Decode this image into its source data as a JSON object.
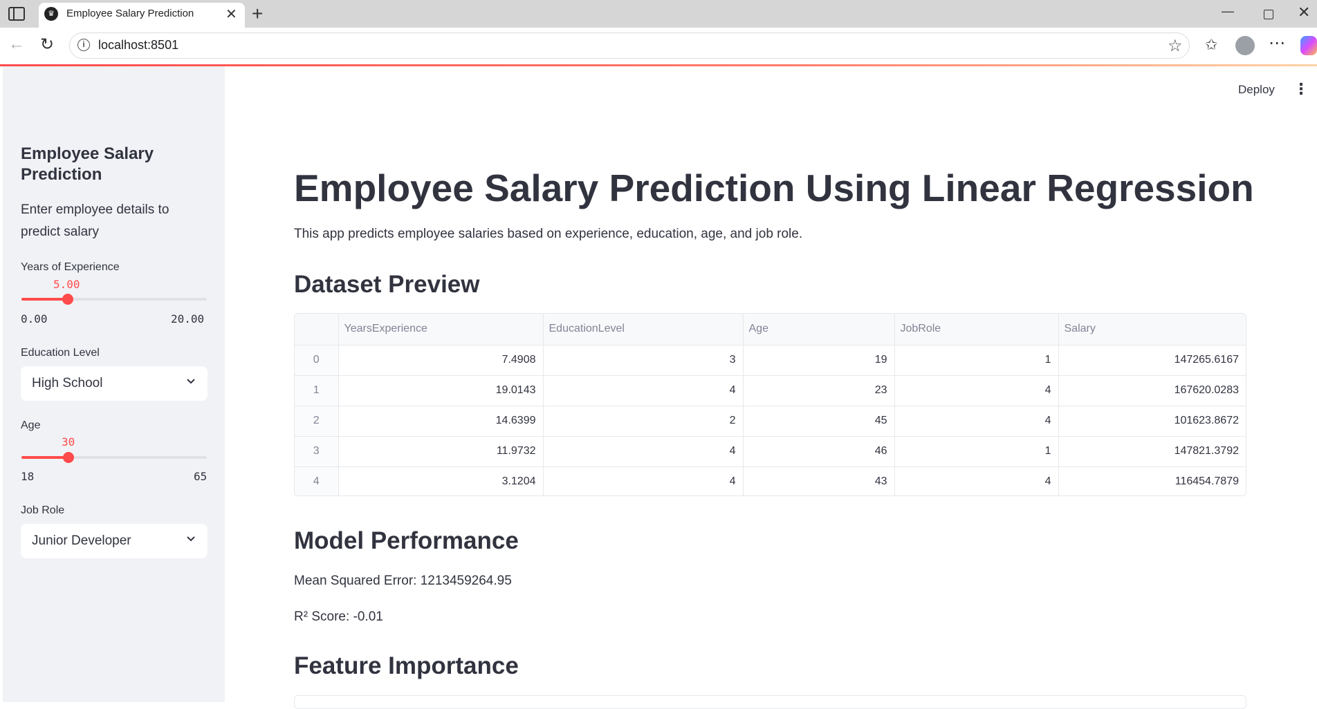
{
  "browser": {
    "tab_title": "Employee Salary Prediction",
    "url": "localhost:8501"
  },
  "header": {
    "deploy_label": "Deploy"
  },
  "sidebar": {
    "title": "Employee Salary Prediction",
    "description": "Enter employee details to predict salary",
    "experience": {
      "label": "Years of Experience",
      "value": "5.00",
      "min": "0.00",
      "max": "20.00",
      "fraction": 0.25
    },
    "education": {
      "label": "Education Level",
      "selected": "High School"
    },
    "age": {
      "label": "Age",
      "value": "30",
      "min": "18",
      "max": "65",
      "fraction": 0.255
    },
    "job_role": {
      "label": "Job Role",
      "selected": "Junior Developer"
    }
  },
  "main": {
    "title": "Employee Salary Prediction Using Linear Regression",
    "description": "This app predicts employee salaries based on experience, education, age, and job role.",
    "dataset_heading": "Dataset Preview",
    "table": {
      "columns": [
        "",
        "YearsExperience",
        "EducationLevel",
        "Age",
        "JobRole",
        "Salary"
      ],
      "rows": [
        [
          "0",
          "7.4908",
          "3",
          "19",
          "1",
          "147265.6167"
        ],
        [
          "1",
          "19.0143",
          "4",
          "23",
          "4",
          "167620.0283"
        ],
        [
          "2",
          "14.6399",
          "2",
          "45",
          "4",
          "101623.8672"
        ],
        [
          "3",
          "11.9732",
          "4",
          "46",
          "1",
          "147821.3792"
        ],
        [
          "4",
          "3.1204",
          "4",
          "43",
          "4",
          "116454.7879"
        ]
      ]
    },
    "performance_heading": "Model Performance",
    "mse": "Mean Squared Error: 1213459264.95",
    "r2": "R² Score: -0.01",
    "feature_heading": "Feature Importance"
  },
  "colors": {
    "accent": "#ff4b4b",
    "sidebar_bg": "#f0f2f6",
    "text": "#31333f"
  }
}
